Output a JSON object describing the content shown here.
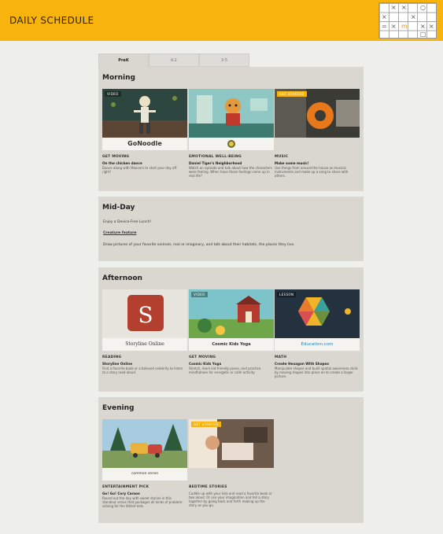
{
  "header": {
    "title": "DAILY SCHEDULE"
  },
  "logo": {
    "glyphs": [
      "×",
      "×",
      "○",
      "×",
      "×",
      "=",
      "×",
      "m",
      "×",
      "×",
      "□"
    ]
  },
  "tabs": [
    {
      "label": "PreK",
      "active": true
    },
    {
      "label": "K-2",
      "active": false
    },
    {
      "label": "3-5",
      "active": false
    }
  ],
  "morning": {
    "heading": "Morning",
    "cards": [
      {
        "badge": "VIDEO",
        "logo_text": "GoNoodle",
        "category": "GET MOVING",
        "name": "On the chicken dance",
        "description": "Dance along with Moovers to start your day off right!"
      },
      {
        "badge": "",
        "logo_text": "",
        "category": "EMOTIONAL WELL-BEING",
        "name": "Daniel Tiger's Neighborhood",
        "description": "Watch an episode and talk about how the characters were feeling. When have those feelings come up in real life?"
      },
      {
        "badge": "GET STARTED",
        "logo_text": "",
        "category": "MUSIC",
        "name": "Make some music!",
        "description": "Use things from around the house as musical instruments and make up a song to share with others."
      }
    ]
  },
  "midday": {
    "heading": "Mid-Day",
    "line1": "Enjoy a Device-Free Lunch!",
    "line2": "Creature feature",
    "line3": "Draw pictures of your favorite animals, real or imaginary, and talk about their habitats, the places they live."
  },
  "afternoon": {
    "heading": "Afternoon",
    "cards": [
      {
        "badge": "",
        "logo_text": "Storyline Online",
        "category": "READING",
        "name": "Storyline Online",
        "description": "Find a favorite book or a beloved celebrity to listen to a story read aloud."
      },
      {
        "badge": "VIDEO",
        "logo_text": "Cosmic Kids Yoga",
        "category": "GET MOVING",
        "name": "Cosmic Kids Yoga",
        "description": "Stretch, learn kid-friendly poses, and practice mindfulness for energetic or calm activity."
      },
      {
        "badge": "LESSON",
        "logo_text": "Education.com",
        "category": "MATH",
        "name": "Create Hexagon With Shapes",
        "description": "Manipulate shapes and build spatial awareness skills by moving shapes into place on to create a larger picture."
      }
    ]
  },
  "evening": {
    "heading": "Evening",
    "cards": [
      {
        "badge": "",
        "logo_text": "common sense",
        "category": "ENTERTAINMENT PICK",
        "name": "Go! Go! Cory Carson",
        "description": "Round out the day with sweet stories in this standout series that packages all kinds of problem-solving for the littlest kids."
      },
      {
        "badge": "GET STARTED",
        "logo_text": "",
        "category": "BEDTIME STORIES",
        "name": "",
        "description": "Cuddle up with your kids and read a favorite book or two aloud. Or use your imagination and tell a story together by going back and forth making up the story as you go."
      }
    ]
  },
  "colors": {
    "brand": "#f8b30c",
    "panel": "#d9d7cf",
    "background": "#eeeeea"
  }
}
